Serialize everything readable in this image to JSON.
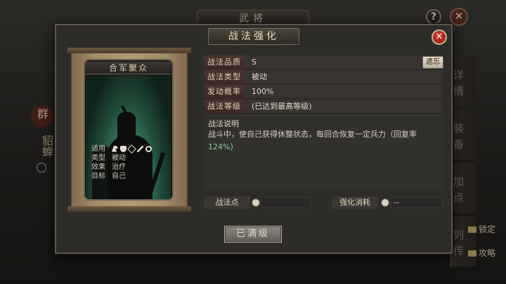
{
  "background": {
    "title": "武将",
    "help_label": "?",
    "close_label": "✕",
    "hero_name": "貂蝉",
    "hero_mark": "群",
    "tabs": [
      "详情",
      "装备",
      "加点",
      "列传"
    ],
    "side_buttons": [
      "锁定",
      "攻略"
    ]
  },
  "dialog": {
    "title": "战法强化",
    "close_label": "✕"
  },
  "card": {
    "name": "合军聚众",
    "info": [
      {
        "k": "适用",
        "v": ""
      },
      {
        "k": "类型",
        "v": "被动"
      },
      {
        "k": "效果",
        "v": "治疗"
      },
      {
        "k": "目标",
        "v": "自己"
      }
    ],
    "unit_icons": [
      "cavalry-icon",
      "shield-icon",
      "crossbow-icon",
      "spear-icon",
      "siege-icon"
    ]
  },
  "attributes": [
    {
      "label": "战法品质",
      "value": "S"
    },
    {
      "label": "战法类型",
      "value": "被动"
    },
    {
      "label": "发动概率",
      "value": "100%"
    },
    {
      "label": "战法等级",
      "value": "(已达到最高等级)"
    }
  ],
  "inherit_button": "遗忘",
  "description": {
    "title": "战法说明",
    "text_before": "战斗中，使自己获得休整状态，每回合恢复一定兵力（回复率",
    "highlight": "124%",
    "text_after": "）"
  },
  "points": {
    "points_label": "战法点",
    "points_value": "",
    "cost_label": "强化消耗",
    "cost_value": "--"
  },
  "max_button": "已满级",
  "colors": {
    "highlight": "#7fd29a",
    "label_bg": "#4a3430",
    "close_red": "#d43a2c"
  }
}
